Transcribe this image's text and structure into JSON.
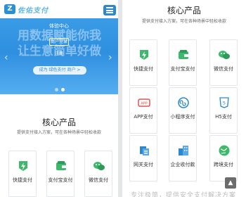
{
  "header": {
    "logo_mark": "Z",
    "logo_text": "佐佑支付"
  },
  "banner": {
    "bg_line1": "用数据赋能你我",
    "bg_line2": "让生意简单好做",
    "title": "体验中心",
    "login": "商户登录",
    "register": "注册",
    "merchant_cta": "成为 绿色支付 商户 >",
    "prev": "‹",
    "next": "›"
  },
  "core": {
    "title": "核心产品",
    "desc": "提供支付接入方案，可在各种场景中轻松收款"
  },
  "left_products": [
    "快捷支付",
    "支付宝支付",
    "微信支付"
  ],
  "right_products": [
    [
      "快捷支付",
      "支付宝支付",
      "微信支付"
    ],
    [
      "APP支付",
      "小程序支付",
      "H5支付"
    ],
    [
      "网关支付",
      "企业收付款",
      "跨境支付"
    ]
  ],
  "icons": {
    "quick": "lightning-icon",
    "alipay": "wallet-icon",
    "wechat": "wechat-icon",
    "app": "app-icon",
    "miniprogram": "miniprogram-icon",
    "h5": "h5-icon",
    "gateway": "gateway-icon",
    "enterprise": "building-icon",
    "crossborder": "globe-icon"
  },
  "bottom_text": "专注极简，提供安全支付解决方案",
  "to_top": "▲",
  "colors": {
    "brand_blue": "#2f8fe0",
    "icon_green": "#3cb96b"
  }
}
